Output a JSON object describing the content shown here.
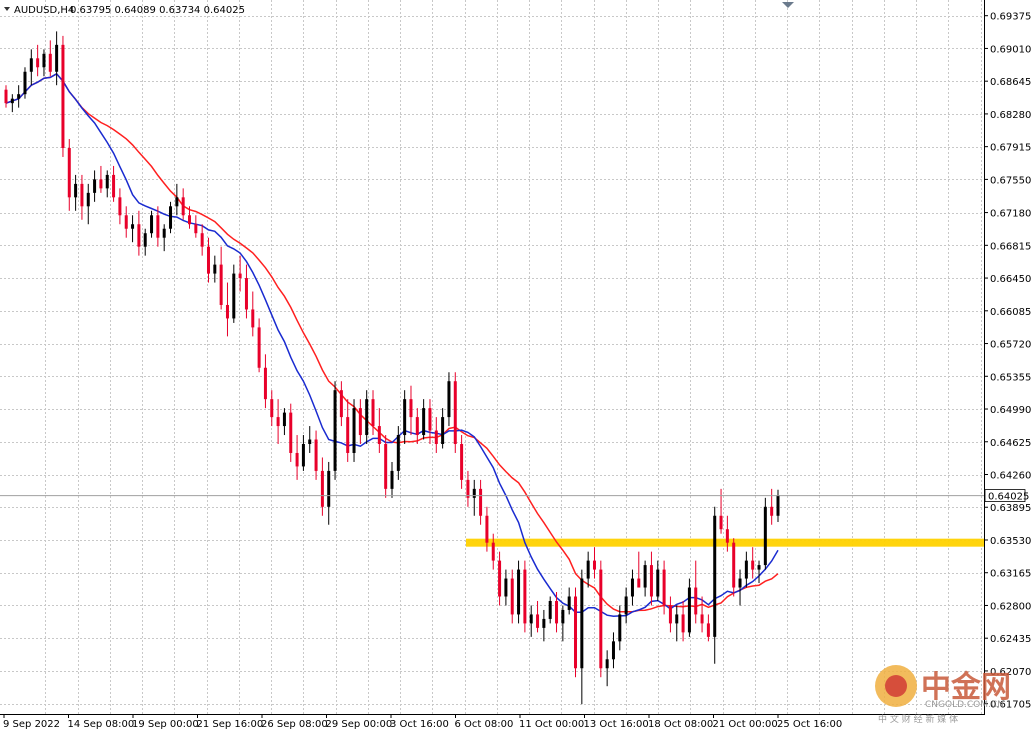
{
  "header": {
    "symbol": "AUDUSD,H4",
    "ohlc": "0.63795 0.64089 0.63734 0.64025"
  },
  "price_axis": {
    "ticks": [
      "0.69375",
      "0.69010",
      "0.68645",
      "0.68280",
      "0.67915",
      "0.67550",
      "0.67180",
      "0.66815",
      "0.66450",
      "0.66085",
      "0.65720",
      "0.65355",
      "0.64990",
      "0.64625",
      "0.64260",
      "0.63895",
      "0.63530",
      "0.63165",
      "0.62800",
      "0.62435",
      "0.62070",
      "0.61705"
    ],
    "current_price_label": "0.64025"
  },
  "time_axis": {
    "labels": [
      "9 Sep 2022",
      "14 Sep 08:00",
      "19 Sep 00:00",
      "21 Sep 16:00",
      "26 Sep 08:00",
      "29 Sep 00:00",
      "3 Oct 16:00",
      "6 Oct 08:00",
      "11 Oct 00:00",
      "13 Oct 16:00",
      "18 Oct 08:00",
      "21 Oct 00:00",
      "25 Oct 16:00"
    ]
  },
  "watermark": {
    "main": "中金网",
    "sub": "中 文 财 经 新 媒 体",
    "url": "CNGOLD.COM.CN"
  },
  "colors": {
    "up": "#000000",
    "down": "#e8002a",
    "ma_slow": "#ff2020",
    "ma_fast": "#1a2bd0",
    "level": "#ffd200",
    "grid": "#c8c8c8"
  },
  "chart_data": {
    "type": "candlestick",
    "symbol": "AUDUSD",
    "timeframe": "H4",
    "ylim": [
      0.6159,
      0.6955
    ],
    "horizontal_level": 0.635,
    "current_price": 0.64025,
    "candles": [
      [
        0.6855,
        0.686,
        0.6835,
        0.684
      ],
      [
        0.684,
        0.685,
        0.683,
        0.6845
      ],
      [
        0.6845,
        0.686,
        0.6835,
        0.685
      ],
      [
        0.685,
        0.688,
        0.6845,
        0.6875
      ],
      [
        0.6875,
        0.69,
        0.686,
        0.689
      ],
      [
        0.689,
        0.6905,
        0.687,
        0.688
      ],
      [
        0.688,
        0.69,
        0.687,
        0.6895
      ],
      [
        0.6895,
        0.691,
        0.687,
        0.6875
      ],
      [
        0.6875,
        0.692,
        0.686,
        0.6905
      ],
      [
        0.6905,
        0.6915,
        0.678,
        0.679
      ],
      [
        0.679,
        0.68,
        0.672,
        0.6735
      ],
      [
        0.6735,
        0.676,
        0.672,
        0.675
      ],
      [
        0.675,
        0.676,
        0.671,
        0.6725
      ],
      [
        0.6725,
        0.675,
        0.6705,
        0.674
      ],
      [
        0.674,
        0.6765,
        0.673,
        0.6755
      ],
      [
        0.6755,
        0.677,
        0.674,
        0.6745
      ],
      [
        0.6745,
        0.6765,
        0.6735,
        0.676
      ],
      [
        0.676,
        0.677,
        0.673,
        0.6735
      ],
      [
        0.6735,
        0.6745,
        0.6705,
        0.6715
      ],
      [
        0.6715,
        0.6725,
        0.669,
        0.67
      ],
      [
        0.67,
        0.6715,
        0.6685,
        0.6705
      ],
      [
        0.6705,
        0.672,
        0.667,
        0.668
      ],
      [
        0.668,
        0.67,
        0.667,
        0.6695
      ],
      [
        0.6695,
        0.672,
        0.669,
        0.6715
      ],
      [
        0.6715,
        0.6725,
        0.668,
        0.669
      ],
      [
        0.669,
        0.6705,
        0.6675,
        0.67
      ],
      [
        0.67,
        0.673,
        0.6695,
        0.6725
      ],
      [
        0.6725,
        0.675,
        0.6715,
        0.6735
      ],
      [
        0.6735,
        0.6745,
        0.671,
        0.6715
      ],
      [
        0.6715,
        0.6725,
        0.67,
        0.6705
      ],
      [
        0.6705,
        0.6715,
        0.669,
        0.6695
      ],
      [
        0.6695,
        0.6705,
        0.667,
        0.668
      ],
      [
        0.668,
        0.669,
        0.664,
        0.665
      ],
      [
        0.665,
        0.667,
        0.664,
        0.666
      ],
      [
        0.666,
        0.668,
        0.661,
        0.6615
      ],
      [
        0.6615,
        0.664,
        0.658,
        0.66
      ],
      [
        0.66,
        0.666,
        0.6595,
        0.665
      ],
      [
        0.665,
        0.667,
        0.663,
        0.6645
      ],
      [
        0.6645,
        0.666,
        0.66,
        0.661
      ],
      [
        0.661,
        0.663,
        0.658,
        0.659
      ],
      [
        0.659,
        0.66,
        0.654,
        0.6545
      ],
      [
        0.6545,
        0.656,
        0.65,
        0.651
      ],
      [
        0.651,
        0.652,
        0.648,
        0.649
      ],
      [
        0.649,
        0.651,
        0.646,
        0.648
      ],
      [
        0.648,
        0.65,
        0.647,
        0.6495
      ],
      [
        0.6495,
        0.6505,
        0.644,
        0.645
      ],
      [
        0.645,
        0.647,
        0.642,
        0.6435
      ],
      [
        0.6435,
        0.647,
        0.643,
        0.646
      ],
      [
        0.646,
        0.648,
        0.645,
        0.6465
      ],
      [
        0.6465,
        0.6475,
        0.642,
        0.643
      ],
      [
        0.643,
        0.6445,
        0.638,
        0.639
      ],
      [
        0.639,
        0.644,
        0.637,
        0.643
      ],
      [
        0.643,
        0.653,
        0.642,
        0.652
      ],
      [
        0.652,
        0.653,
        0.648,
        0.649
      ],
      [
        0.649,
        0.651,
        0.644,
        0.645
      ],
      [
        0.645,
        0.651,
        0.644,
        0.65
      ],
      [
        0.65,
        0.651,
        0.646,
        0.647
      ],
      [
        0.647,
        0.652,
        0.646,
        0.651
      ],
      [
        0.651,
        0.652,
        0.647,
        0.648
      ],
      [
        0.648,
        0.65,
        0.645,
        0.646
      ],
      [
        0.646,
        0.647,
        0.64,
        0.641
      ],
      [
        0.641,
        0.644,
        0.64,
        0.643
      ],
      [
        0.643,
        0.648,
        0.642,
        0.647
      ],
      [
        0.647,
        0.652,
        0.646,
        0.651
      ],
      [
        0.651,
        0.6525,
        0.647,
        0.649
      ],
      [
        0.649,
        0.65,
        0.646,
        0.647
      ],
      [
        0.647,
        0.651,
        0.6465,
        0.65
      ],
      [
        0.65,
        0.651,
        0.646,
        0.6475
      ],
      [
        0.6475,
        0.649,
        0.645,
        0.646
      ],
      [
        0.646,
        0.65,
        0.6455,
        0.649
      ],
      [
        0.649,
        0.654,
        0.648,
        0.653
      ],
      [
        0.653,
        0.654,
        0.645,
        0.646
      ],
      [
        0.646,
        0.647,
        0.641,
        0.642
      ],
      [
        0.642,
        0.643,
        0.639,
        0.64
      ],
      [
        0.64,
        0.642,
        0.638,
        0.641
      ],
      [
        0.641,
        0.642,
        0.637,
        0.638
      ],
      [
        0.638,
        0.639,
        0.634,
        0.635
      ],
      [
        0.635,
        0.636,
        0.632,
        0.633
      ],
      [
        0.633,
        0.634,
        0.628,
        0.629
      ],
      [
        0.629,
        0.632,
        0.628,
        0.631
      ],
      [
        0.631,
        0.632,
        0.626,
        0.627
      ],
      [
        0.627,
        0.633,
        0.626,
        0.632
      ],
      [
        0.632,
        0.633,
        0.625,
        0.626
      ],
      [
        0.626,
        0.628,
        0.6245,
        0.627
      ],
      [
        0.627,
        0.6285,
        0.625,
        0.6255
      ],
      [
        0.6255,
        0.6275,
        0.624,
        0.6265
      ],
      [
        0.6265,
        0.629,
        0.626,
        0.6285
      ],
      [
        0.6285,
        0.6295,
        0.625,
        0.626
      ],
      [
        0.626,
        0.628,
        0.624,
        0.6275
      ],
      [
        0.6275,
        0.63,
        0.627,
        0.629
      ],
      [
        0.629,
        0.63,
        0.62,
        0.621
      ],
      [
        0.621,
        0.632,
        0.617,
        0.631
      ],
      [
        0.631,
        0.634,
        0.63,
        0.633
      ],
      [
        0.633,
        0.6345,
        0.631,
        0.632
      ],
      [
        0.632,
        0.633,
        0.62,
        0.621
      ],
      [
        0.621,
        0.623,
        0.619,
        0.622
      ],
      [
        0.622,
        0.625,
        0.621,
        0.624
      ],
      [
        0.624,
        0.628,
        0.623,
        0.627
      ],
      [
        0.627,
        0.63,
        0.626,
        0.629
      ],
      [
        0.629,
        0.632,
        0.628,
        0.631
      ],
      [
        0.631,
        0.634,
        0.63,
        0.63
      ],
      [
        0.63,
        0.633,
        0.629,
        0.6325
      ],
      [
        0.6325,
        0.634,
        0.628,
        0.629
      ],
      [
        0.629,
        0.633,
        0.6285,
        0.632
      ],
      [
        0.632,
        0.633,
        0.627,
        0.628
      ],
      [
        0.628,
        0.629,
        0.625,
        0.626
      ],
      [
        0.626,
        0.628,
        0.624,
        0.627
      ],
      [
        0.627,
        0.6285,
        0.624,
        0.625
      ],
      [
        0.625,
        0.631,
        0.6245,
        0.63
      ],
      [
        0.63,
        0.633,
        0.626,
        0.627
      ],
      [
        0.627,
        0.629,
        0.625,
        0.626
      ],
      [
        0.626,
        0.627,
        0.624,
        0.6245
      ],
      [
        0.6245,
        0.639,
        0.6215,
        0.638
      ],
      [
        0.638,
        0.641,
        0.636,
        0.6365
      ],
      [
        0.6365,
        0.638,
        0.634,
        0.635
      ],
      [
        0.635,
        0.6355,
        0.629,
        0.63
      ],
      [
        0.63,
        0.632,
        0.628,
        0.631
      ],
      [
        0.631,
        0.634,
        0.63,
        0.633
      ],
      [
        0.633,
        0.6345,
        0.631,
        0.632
      ],
      [
        0.632,
        0.633,
        0.6305,
        0.6325
      ],
      [
        0.6325,
        0.64,
        0.632,
        0.639
      ],
      [
        0.639,
        0.641,
        0.637,
        0.638
      ],
      [
        0.638,
        0.6409,
        0.6373,
        0.6403
      ]
    ],
    "ma_fast": {
      "name": "",
      "color": "#1a2bd0"
    },
    "ma_slow": {
      "name": "",
      "color": "#ff2020"
    }
  }
}
